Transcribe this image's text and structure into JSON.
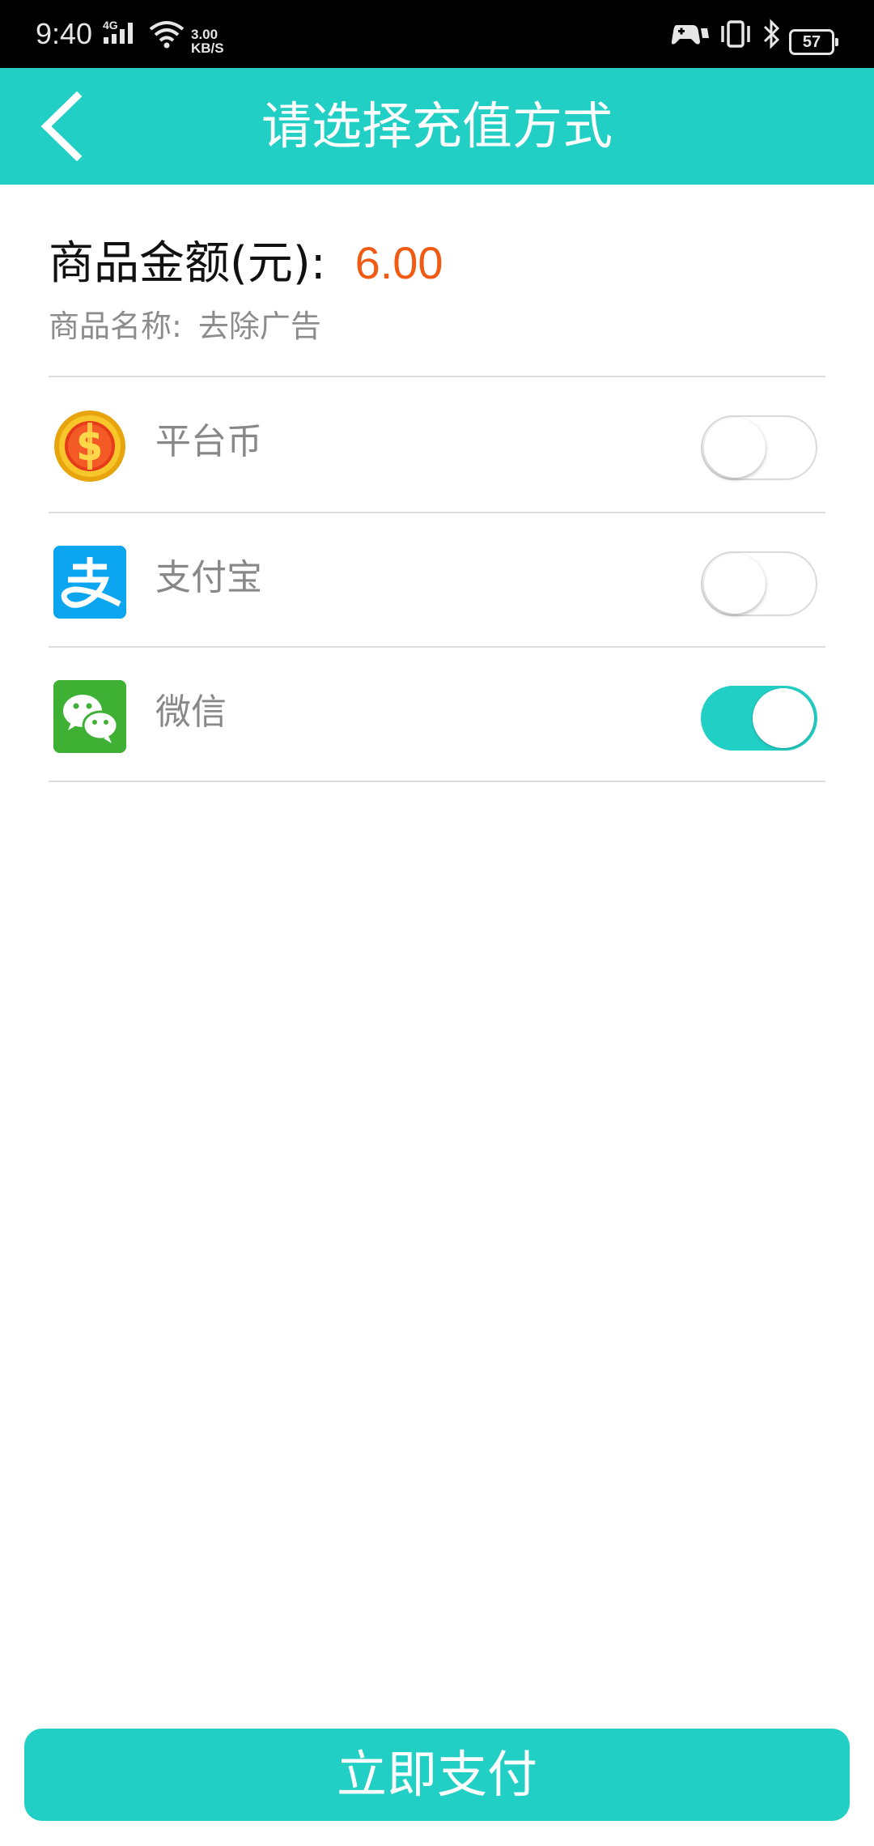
{
  "status_bar": {
    "time": "9:40",
    "network_type": "4G",
    "speed_value": "3.00",
    "speed_unit": "KB/S",
    "battery": "57",
    "icons": [
      "signal-icon",
      "wifi-icon",
      "game-controller-icon",
      "vibrate-icon",
      "bluetooth-icon",
      "battery-icon"
    ]
  },
  "header": {
    "title": "请选择充值方式",
    "back_icon": "chevron-left-icon",
    "background_color": "#22cfc5"
  },
  "order": {
    "amount_label": "商品金额(元):",
    "amount_value": "6.00",
    "amount_color": "#f05a12",
    "product_label": "商品名称:",
    "product_name": "去除广告"
  },
  "payment_methods": [
    {
      "label": "平台币",
      "icon": "platform-coin-icon",
      "selected": false
    },
    {
      "label": "支付宝",
      "icon": "alipay-icon",
      "selected": false
    },
    {
      "label": "微信",
      "icon": "wechat-icon",
      "selected": true
    }
  ],
  "pay_button": {
    "label": "立即支付"
  }
}
